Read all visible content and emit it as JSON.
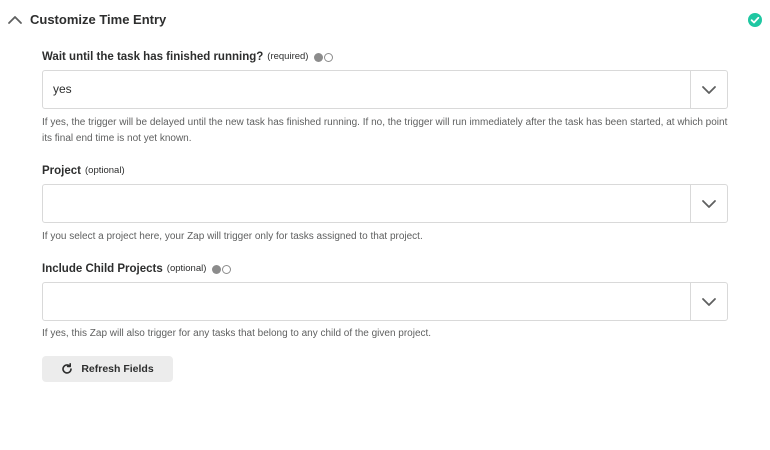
{
  "header": {
    "title": "Customize Time Entry",
    "collapse_icon": "chevron-up-icon",
    "status_icon": "check-circle-icon",
    "status_color": "#1fc7a2"
  },
  "fields": [
    {
      "label": "Wait until the task has finished running?",
      "qualifier": "(required)",
      "has_toggle": true,
      "value": "yes",
      "help": "If yes, the trigger will be delayed until the new task has finished running. If no, the trigger will run immediately after the task has been started, at which point its final end time is not yet known."
    },
    {
      "label": "Project",
      "qualifier": "(optional)",
      "has_toggle": false,
      "value": "",
      "help": "If you select a project here, your Zap will trigger only for tasks assigned to that project."
    },
    {
      "label": "Include Child Projects",
      "qualifier": "(optional)",
      "has_toggle": true,
      "value": "",
      "help": "If yes, this Zap will also trigger for any tasks that belong to any child of the given project."
    }
  ],
  "refresh_button": {
    "label": "Refresh Fields",
    "icon": "refresh-icon"
  }
}
